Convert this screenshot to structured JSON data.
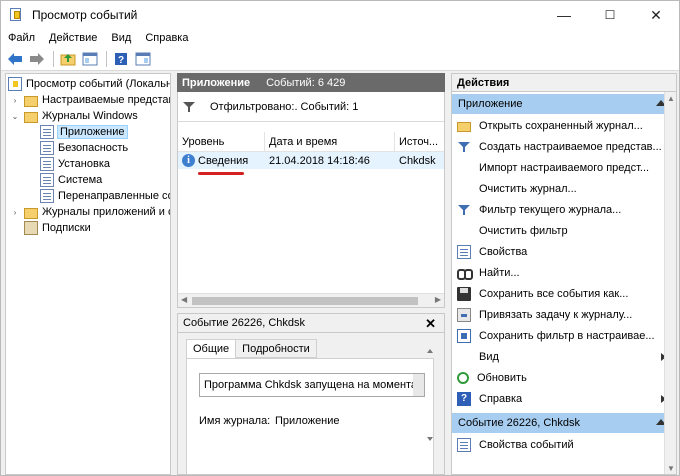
{
  "window": {
    "title": "Просмотр событий",
    "minimize": "—",
    "maximize": "☐",
    "close": "✕"
  },
  "menu": [
    "Файл",
    "Действие",
    "Вид",
    "Справка"
  ],
  "toolbar": {
    "buttons": [
      "back-icon",
      "forward-icon",
      "up-folder-icon",
      "show-hide-tree-icon",
      "help-icon",
      "show-hide-actions-icon"
    ]
  },
  "tree": {
    "items": [
      {
        "label": "Просмотр событий (Локальный)",
        "expander": "",
        "icon": "event-viewer-icon",
        "level": 0
      },
      {
        "label": "Настраиваемые представления",
        "expander": "›",
        "icon": "folder-icon",
        "level": 1
      },
      {
        "label": "Журналы Windows",
        "expander": "⌄",
        "icon": "folder-icon",
        "level": 1
      },
      {
        "label": "Приложение",
        "expander": "",
        "icon": "log-icon",
        "level": 2,
        "selected": true
      },
      {
        "label": "Безопасность",
        "expander": "",
        "icon": "log-icon",
        "level": 2
      },
      {
        "label": "Установка",
        "expander": "",
        "icon": "log-icon",
        "level": 2
      },
      {
        "label": "Система",
        "expander": "",
        "icon": "log-icon",
        "level": 2
      },
      {
        "label": "Перенаправленные события",
        "expander": "",
        "icon": "log-icon",
        "level": 2
      },
      {
        "label": "Журналы приложений и служб",
        "expander": "›",
        "icon": "folder-icon",
        "level": 1
      },
      {
        "label": "Подписки",
        "expander": "",
        "icon": "subscriptions-icon",
        "level": 1
      }
    ]
  },
  "center": {
    "header_title": "Приложение",
    "header_count": "Событий: 6 429",
    "filter_text": "Отфильтровано:. Событий: 1",
    "columns": [
      "Уровень",
      "Дата и время",
      "Источ..."
    ],
    "row": {
      "level": "Сведения",
      "datetime": "21.04.2018 14:18:46",
      "source": "Chkdsk"
    }
  },
  "detail": {
    "title": "Событие 26226, Chkdsk",
    "close": "✕",
    "tabs": [
      "Общие",
      "Подробности"
    ],
    "message": "Программа Chkdsk запущена на моментальн",
    "field_label": "Имя журнала:",
    "field_value": "Приложение"
  },
  "actions": {
    "header": "Действия",
    "section1": "Приложение",
    "items1": [
      {
        "label": "Открыть сохраненный журнал...",
        "icon": "open-folder-icon"
      },
      {
        "label": "Создать настраиваемое представ...",
        "icon": "filter-icon"
      },
      {
        "label": "Импорт настраиваемого предст...",
        "icon": ""
      },
      {
        "label": "Очистить журнал...",
        "icon": ""
      },
      {
        "label": "Фильтр текущего журнала...",
        "icon": "filter-icon"
      },
      {
        "label": "Очистить фильтр",
        "icon": ""
      },
      {
        "label": "Свойства",
        "icon": "properties-icon"
      },
      {
        "label": "Найти...",
        "icon": "find-icon"
      },
      {
        "label": "Сохранить все события как...",
        "icon": "save-icon"
      },
      {
        "label": "Привязать задачу к журналу...",
        "icon": "task-icon"
      },
      {
        "label": "Сохранить фильтр в настраивае...",
        "icon": "save-filter-icon"
      },
      {
        "label": "Вид",
        "icon": "",
        "submenu": true
      },
      {
        "label": "Обновить",
        "icon": "refresh-icon"
      },
      {
        "label": "Справка",
        "icon": "help-icon",
        "submenu": true
      }
    ],
    "section2": "Событие 26226, Chkdsk",
    "items2": [
      {
        "label": "Свойства событий",
        "icon": "event-properties-icon"
      }
    ]
  }
}
